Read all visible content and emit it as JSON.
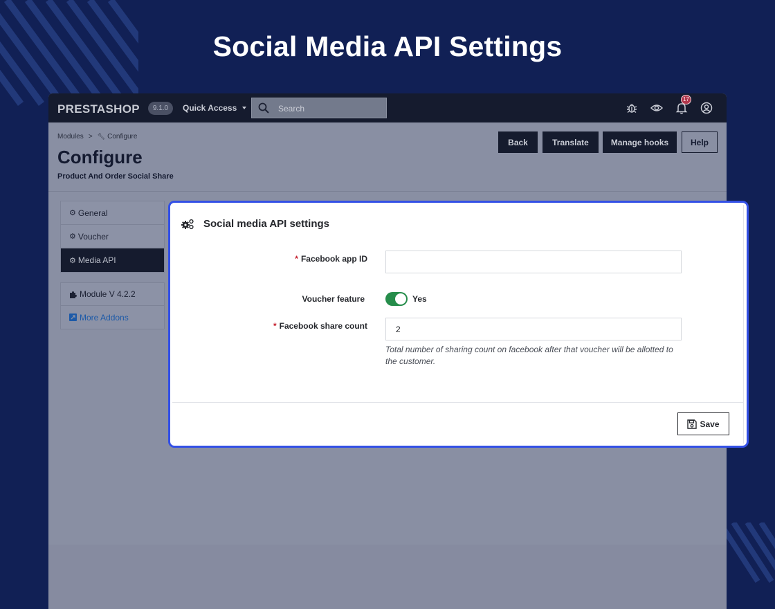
{
  "page_heading": "Social Media API Settings",
  "topbar": {
    "logo": "PRESTASHOP",
    "version": "9.1.0",
    "quick_access": "Quick Access",
    "search_placeholder": "Search",
    "notification_count": "17",
    "icons": [
      "bug-icon",
      "eye-icon",
      "bell-icon",
      "user-circle-icon"
    ]
  },
  "header": {
    "breadcrumb": [
      "Modules",
      "Configure"
    ],
    "breadcrumb_separator": ">",
    "title": "Configure",
    "subtitle": "Product And Order Social Share",
    "buttons": [
      "Back",
      "Translate",
      "Manage hooks",
      "Help"
    ]
  },
  "sidebar": {
    "items": [
      {
        "label": "General",
        "active": false
      },
      {
        "label": "Voucher",
        "active": false
      },
      {
        "label": "Media API",
        "active": true
      }
    ],
    "module_version": "Module V 4.2.2",
    "more_addons": "More Addons"
  },
  "panel": {
    "title": "Social media API settings",
    "required_mark": "*",
    "fields": {
      "facebook_app_id": {
        "label": "Facebook app ID",
        "value": ""
      },
      "voucher_feature": {
        "label": "Voucher feature",
        "state": "Yes"
      },
      "facebook_share_count": {
        "label": "Facebook share count",
        "value": "2",
        "help": "Total number of sharing count on facebook after that voucher will be allotted to the customer."
      }
    },
    "save_label": "Save"
  },
  "colors": {
    "background": "#112055",
    "topbar": "#151b2e",
    "highlight_border": "#3350e6",
    "toggle_on": "#268d4b",
    "required": "#c5202e",
    "link": "#1d5aa8"
  }
}
